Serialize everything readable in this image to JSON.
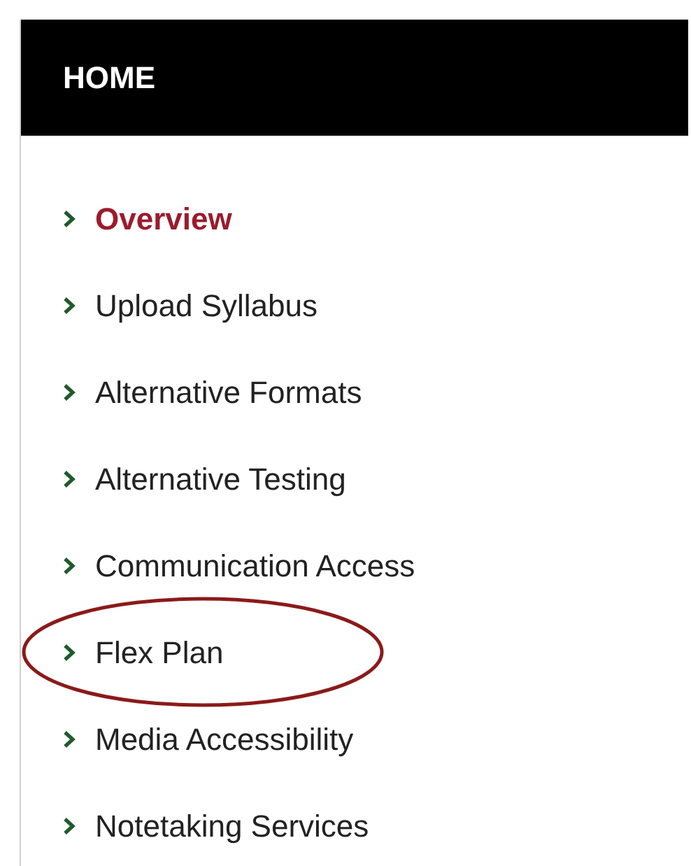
{
  "header": {
    "title": "HOME"
  },
  "menu": [
    {
      "label": "Overview",
      "selected": true,
      "circled": false
    },
    {
      "label": "Upload Syllabus",
      "selected": false,
      "circled": false
    },
    {
      "label": "Alternative Formats",
      "selected": false,
      "circled": false
    },
    {
      "label": "Alternative Testing",
      "selected": false,
      "circled": false
    },
    {
      "label": "Communication Access",
      "selected": false,
      "circled": false
    },
    {
      "label": "Flex Plan",
      "selected": false,
      "circled": true
    },
    {
      "label": "Media Accessibility",
      "selected": false,
      "circled": false
    },
    {
      "label": "Notetaking Services",
      "selected": false,
      "circled": false
    }
  ]
}
